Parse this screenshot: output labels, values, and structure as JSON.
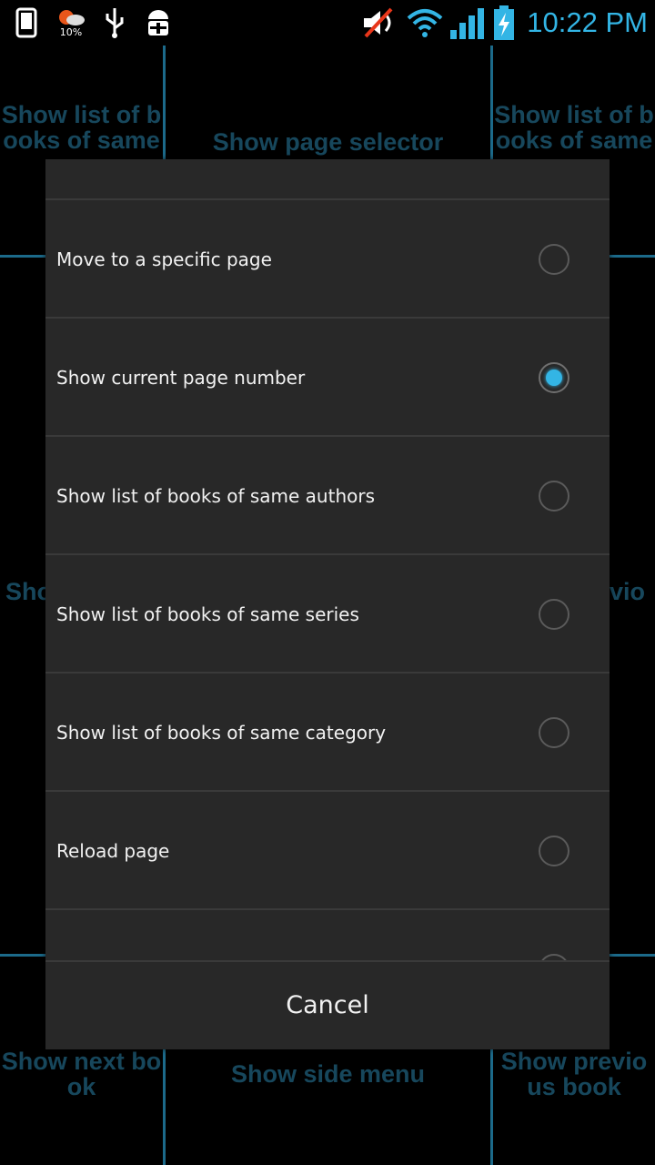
{
  "status_bar": {
    "time": "10:22 PM",
    "weather_percent": "10%",
    "icons": [
      "phone-icon",
      "weather-icon",
      "usb-icon",
      "android-debug-icon",
      "volume-muted-icon",
      "wifi-icon",
      "signal-icon",
      "battery-charging-icon"
    ],
    "accent_color": "#33b5e5"
  },
  "tap_zones": {
    "top_left": "Show list of b ooks of same",
    "top_center": "Show page selector",
    "top_right": "Show list of b ooks of same",
    "middle_left": "Sho",
    "middle_right": "vio",
    "bottom_left": "Show next bo ok",
    "bottom_center": "Show side menu",
    "bottom_right": "Show previo us book"
  },
  "dialog": {
    "items": [
      {
        "label": "Move to a specific page",
        "selected": false
      },
      {
        "label": "Show current page number",
        "selected": true
      },
      {
        "label": "Show list of books of same authors",
        "selected": false
      },
      {
        "label": "Show list of books of same series",
        "selected": false
      },
      {
        "label": "Show list of books of same category",
        "selected": false
      },
      {
        "label": "Reload page",
        "selected": false
      }
    ],
    "cancel_label": "Cancel"
  }
}
